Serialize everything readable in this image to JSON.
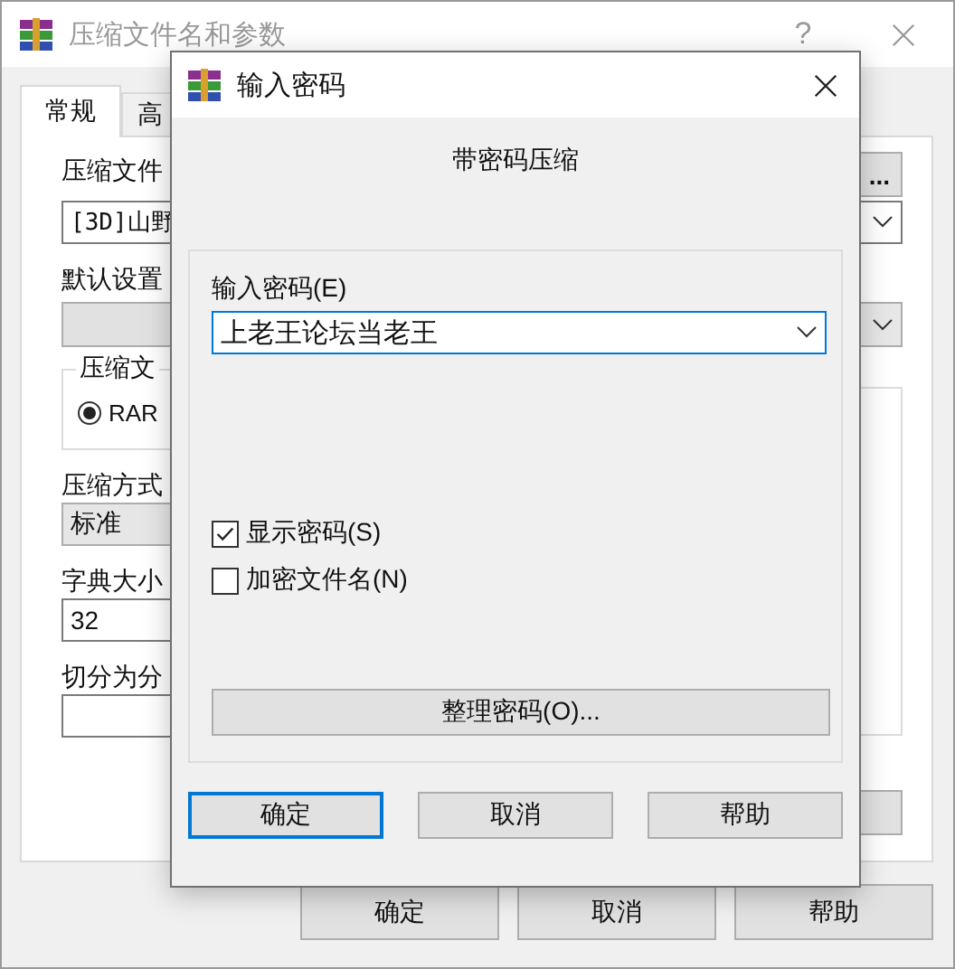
{
  "background_window": {
    "title": "压缩文件名和参数",
    "help_button": "?",
    "tabs": [
      {
        "label": "常规",
        "selected": true
      },
      {
        "label": "高",
        "selected": false
      }
    ],
    "archive_name_label": "压缩文件",
    "archive_name_value": "[3D]山野",
    "browse_button": "...",
    "default_settings_label": "默认设置",
    "format_group_label": "压缩文",
    "format_options": [
      {
        "label": "RAR",
        "selected": true
      }
    ],
    "method_label": "压缩方式",
    "method_value": "标准",
    "dictionary_label": "字典大小",
    "dictionary_value": "32",
    "split_label": "切分为分",
    "buttons": [
      "确定",
      "取消",
      "帮助"
    ]
  },
  "dialog": {
    "title": "输入密码",
    "heading": "带密码压缩",
    "password_label": "输入密码(E)",
    "password_value": "上老王论坛当老王",
    "options": [
      {
        "label": "显示密码(S)",
        "checked": true
      },
      {
        "label": "加密文件名(N)",
        "checked": false
      }
    ],
    "organize_button": "整理密码(O)...",
    "buttons": [
      {
        "label": "确定",
        "default": true
      },
      {
        "label": "取消",
        "default": false
      },
      {
        "label": "帮助",
        "default": false
      }
    ]
  }
}
